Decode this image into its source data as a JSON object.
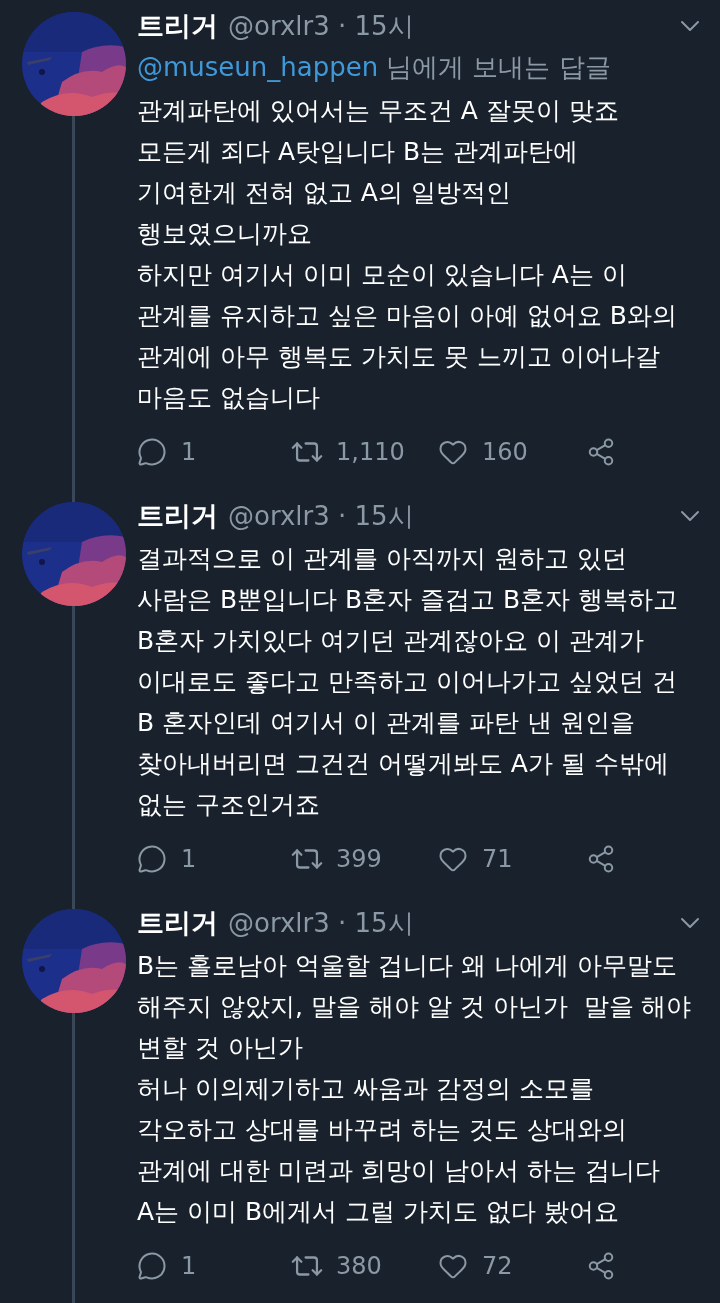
{
  "tweets": [
    {
      "name": "트리거",
      "meta": "@orxlr3 · 15시",
      "reply_to": {
        "handle": "@museun_happen",
        "text": "님에게 보내는 답글"
      },
      "lines": [
        "관계파탄에 있어서는 무조건 A 잘못이 맞죠",
        "모든게 죄다 A탓입니다 B는 관계파탄에",
        "기여한게 전혀 없고 A의 일방적인",
        "행보였으니까요",
        "하지만 여기서 이미 모순이 있습니다 A는 이",
        "관계를 유지하고 싶은 마음이 아예 없어요 B와의",
        "관계에 아무 행복도 가치도 못 느끼고 이어나갈",
        "마음도 없습니다"
      ],
      "replies": "1",
      "retweets": "1,110",
      "likes": "160"
    },
    {
      "name": "트리거",
      "meta": "@orxlr3 · 15시",
      "lines": [
        "결과적으로 이 관계를 아직까지 원하고 있던",
        "사람은 B뿐입니다 B혼자 즐겁고 B혼자 행복하고",
        "B혼자 가치있다 여기던 관계잖아요 이 관계가",
        "이대로도 좋다고 만족하고 이어나가고 싶었던 건",
        "B 혼자인데 여기서 이 관계를 파탄 낸 원인을",
        "찾아내버리면 그건건 어떻게봐도 A가 될 수밖에",
        "없는 구조인거죠"
      ],
      "replies": "1",
      "retweets": "399",
      "likes": "71"
    },
    {
      "name": "트리거",
      "meta": "@orxlr3 · 15시",
      "lines": [
        "B는 홀로남아 억울할 겁니다 왜 나에게 아무말도",
        "해주지 않았지, 말을 해야 알 것 아닌가  말을 해야",
        "변할 것 아닌가",
        "허나 이의제기하고 싸움과 감정의 소모를",
        "각오하고 상대를 바꾸려 하는 것도 상대와의",
        "관계에 대한 미련과 희망이 남아서 하는 겁니다",
        "A는 이미 B에게서 그럴 가치도 없다 봤어요"
      ],
      "replies": "1",
      "retweets": "380",
      "likes": "72"
    }
  ]
}
